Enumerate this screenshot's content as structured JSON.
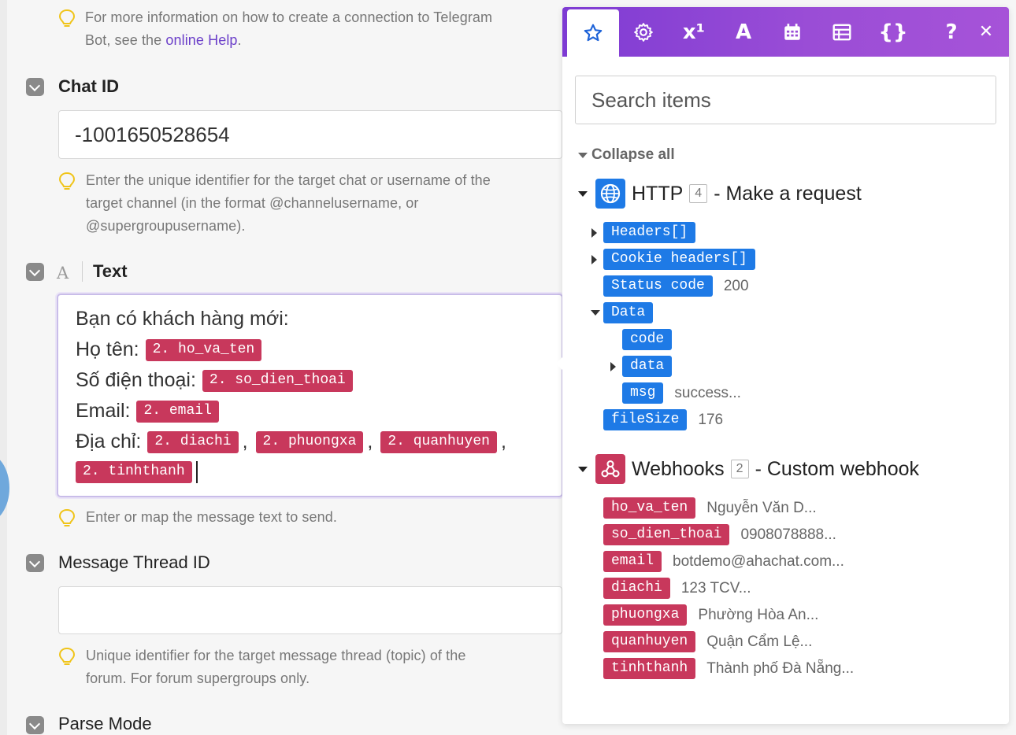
{
  "form": {
    "top_hint": {
      "text_before": "For more information on how to create a connection to Telegram\nBot, see the ",
      "link": "online Help",
      "text_after": "."
    },
    "chat_id": {
      "label": "Chat ID",
      "value": "-1001650528654",
      "hint": "Enter the unique identifier for the target chat or username of the\ntarget channel (in the format @channelusername, or\n@supergroupusername)."
    },
    "text": {
      "label": "Text",
      "type_icon": "A",
      "lines": [
        {
          "text": "Bạn có khách hàng mới:"
        },
        {
          "text": "Họ tên:",
          "pill": "2. ho_va_ten"
        },
        {
          "text": "Số điện thoại:",
          "pill": "2. so_dien_thoai"
        },
        {
          "text": "Email:",
          "pill": "2. email"
        },
        {
          "text": "Địa chỉ:",
          "pills": [
            "2. diachi",
            "2. phuongxa",
            "2. quanhuyen",
            "2. tinhthanh"
          ]
        }
      ],
      "comma": ",",
      "hint": "Enter or map the message text to send."
    },
    "thread": {
      "label": "Message Thread ID",
      "value": "",
      "hint": "Unique identifier for the target message thread (topic) of the\nforum. For forum supergroups only."
    },
    "parse_mode": {
      "label": "Parse Mode"
    }
  },
  "panel": {
    "tabs": [
      {
        "name": "star-icon",
        "active": true
      },
      {
        "name": "gear-icon"
      },
      {
        "name": "superscript-icon",
        "glyph": "x¹"
      },
      {
        "name": "text-format-icon",
        "glyph": "A"
      },
      {
        "name": "calendar-icon"
      },
      {
        "name": "table-icon"
      },
      {
        "name": "braces-icon",
        "glyph": "{}"
      },
      {
        "name": "help-icon",
        "glyph": "?"
      },
      {
        "name": "close-icon",
        "glyph": "✕"
      }
    ],
    "search_placeholder": "Search items",
    "collapse_all": "Collapse all",
    "http": {
      "name": "HTTP",
      "count": "4",
      "desc": "- Make a request",
      "items": [
        {
          "tag": "Headers[]",
          "value": ""
        },
        {
          "tag": "Cookie headers[]",
          "value": ""
        },
        {
          "tag": "Status code",
          "value": "200"
        },
        {
          "tag": "Data",
          "value": ""
        },
        {
          "tag": "code",
          "value": ""
        },
        {
          "tag": "data",
          "value": ""
        },
        {
          "tag": "msg",
          "value": "success..."
        },
        {
          "tag": "fileSize",
          "value": "176"
        }
      ]
    },
    "webhooks": {
      "name": "Webhooks",
      "count": "2",
      "desc": "- Custom webhook",
      "items": [
        {
          "tag": "ho_va_ten",
          "value": "Nguyễn Văn D..."
        },
        {
          "tag": "so_dien_thoai",
          "value": "0908078888..."
        },
        {
          "tag": "email",
          "value": "botdemo@ahachat.com..."
        },
        {
          "tag": "diachi",
          "value": "123 TCV..."
        },
        {
          "tag": "phuongxa",
          "value": "Phường Hòa An..."
        },
        {
          "tag": "quanhuyen",
          "value": "Quận Cẩm Lệ..."
        },
        {
          "tag": "tinhthanh",
          "value": "Thành phố Đà Nẵng..."
        }
      ]
    },
    "colors": {
      "tab_gradient_start": "#7e3bd3",
      "tab_gradient_end": "#a653d8",
      "http_blue": "#1e7ae6",
      "webhook_red": "#c8385c"
    }
  }
}
